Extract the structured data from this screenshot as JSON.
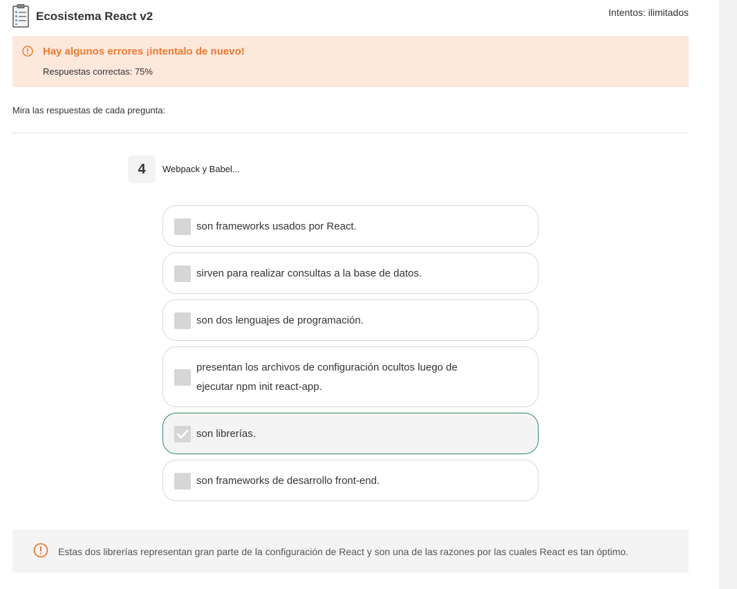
{
  "header": {
    "title": "Ecosistema React v2",
    "attempts": "Intentos: ilimitados",
    "icon": "clipboard-icon"
  },
  "alert": {
    "title": "Hay algunos errores ¡intentalo de nuevo!",
    "subtitle": "Respuestas correctas: 75%",
    "color": "#ee7a33",
    "background": "#fde8dc",
    "icon": "warning-circle-icon"
  },
  "instruction": "Mira las respuestas de cada pregunta:",
  "question": {
    "number": "4",
    "text": "Webpack y Babel..."
  },
  "options": [
    {
      "label": "son frameworks usados por React.",
      "checked": false
    },
    {
      "label": "sirven para realizar consultas a la base de datos.",
      "checked": false
    },
    {
      "label": "son dos lenguajes de programación.",
      "checked": false
    },
    {
      "label": "presentan los archivos de configuración ocultos luego de ejecutar npm init react-app.",
      "checked": false
    },
    {
      "label": "son librerías.",
      "checked": true
    },
    {
      "label": "son frameworks de desarrollo front-end.",
      "checked": false
    }
  ],
  "feedback": {
    "text": "Estas dos librerías representan gran parte de la configuración de React y son una de las razones por las cuales React es tan óptimo.",
    "icon": "info-circle-icon",
    "icon_color": "#ee7a33"
  },
  "colors": {
    "correct_border": "#2c8f5c",
    "checkbox": "#d6d6d6"
  }
}
